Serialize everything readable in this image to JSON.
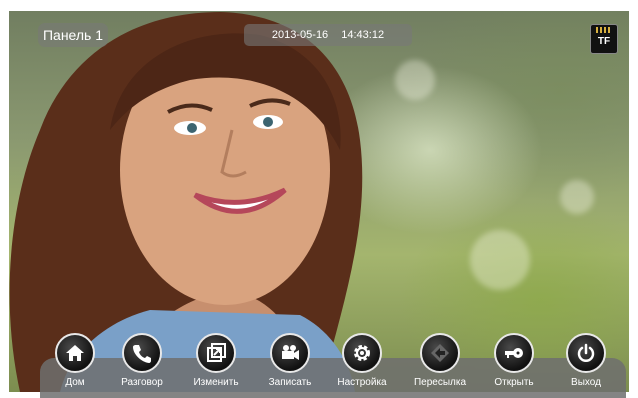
{
  "panel_label": "Панель 1",
  "datetime": {
    "date": "2013-05-16",
    "time": "14:43:12"
  },
  "sd_card_label": "TF",
  "toolbar": {
    "buttons": [
      {
        "key": "home",
        "label": "Дом",
        "icon": "home-icon"
      },
      {
        "key": "talk",
        "label": "Разговор",
        "icon": "phone-icon"
      },
      {
        "key": "change",
        "label": "Изменить",
        "icon": "switch-window-icon"
      },
      {
        "key": "record",
        "label": "Записать",
        "icon": "video-camera-icon"
      },
      {
        "key": "settings",
        "label": "Настройка",
        "icon": "gear-icon"
      },
      {
        "key": "forward",
        "label": "Пересылка",
        "icon": "forward-diamond-icon"
      },
      {
        "key": "open",
        "label": "Открыть",
        "icon": "key-icon"
      },
      {
        "key": "exit",
        "label": "Выход",
        "icon": "power-icon"
      }
    ]
  }
}
